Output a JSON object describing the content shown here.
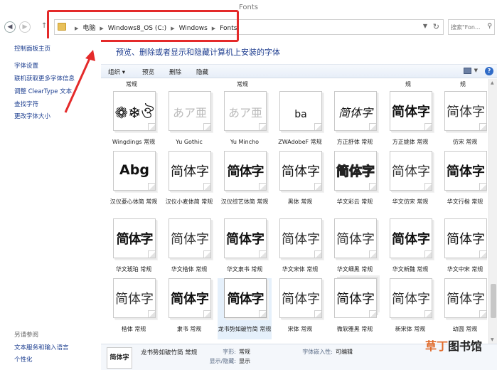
{
  "window": {
    "title": "Fonts"
  },
  "address": {
    "crumbs": [
      "电脑",
      "Windows8_OS (C:)",
      "Windows",
      "Fonts"
    ],
    "search_placeholder": "搜索\"Fon..."
  },
  "left_pane": {
    "links": [
      "控制面板主页",
      "字体设置",
      "联机获取更多字体信息",
      "调整 ClearType 文本",
      "查找字符",
      "更改字体大小"
    ],
    "see_also_title": "另请参阅",
    "see_also_links": [
      "文本服务和输入语言",
      "个性化"
    ]
  },
  "heading": "预览、删除或者显示和隐藏计算机上安装的字体",
  "toolbar": {
    "organize": "组织 ▾",
    "preview": "预览",
    "delete": "删除",
    "hide": "隐藏",
    "help": "?"
  },
  "top_row_labels": [
    "常规",
    "常规",
    "规",
    "规"
  ],
  "fonts": [
    {
      "sample": "❁❄ঔ",
      "name": "Wingdings 常规",
      "style": "sym"
    },
    {
      "sample": "あア亜",
      "name": "Yu Gothic",
      "style": "ghost"
    },
    {
      "sample": "あア亜",
      "name": "Yu Mincho",
      "style": "ghost"
    },
    {
      "sample": "ba",
      "name": "ZWAdobeF 常规",
      "style": "ba"
    },
    {
      "sample": "简体字",
      "name": "方正舒体 常规",
      "style": "cs"
    },
    {
      "sample": "简体字",
      "name": "方正姚体 常规",
      "style": "cb"
    },
    {
      "sample": "简体字",
      "name": "仿宋 常规",
      "style": "cl"
    },
    {
      "sample": "Abg",
      "name": "汉仪菱心体简 常规",
      "style": "abg"
    },
    {
      "sample": "简体字",
      "name": "汉仪小麦体简 常规",
      "style": "cm"
    },
    {
      "sample": "简体字",
      "name": "汉仪综艺体简 常规",
      "style": "cx"
    },
    {
      "sample": "简体字",
      "name": "黑体 常规",
      "style": "cm"
    },
    {
      "sample": "简体字",
      "name": "华文彩云 常规",
      "style": "co"
    },
    {
      "sample": "简体字",
      "name": "华文仿宋 常规",
      "style": "cl"
    },
    {
      "sample": "简体字",
      "name": "华文行楷 常规",
      "style": "cb"
    },
    {
      "sample": "简体字",
      "name": "华文琥珀 常规",
      "style": "cx"
    },
    {
      "sample": "简体字",
      "name": "华文楷体 常规",
      "style": "cl"
    },
    {
      "sample": "简体字",
      "name": "华文隶书 常规",
      "style": "cb"
    },
    {
      "sample": "简体字",
      "name": "华文宋体 常规",
      "style": "cl"
    },
    {
      "sample": "简体字",
      "name": "华文细黑 常规",
      "style": "cl"
    },
    {
      "sample": "简体字",
      "name": "华文新魏 常规",
      "style": "cb"
    },
    {
      "sample": "简体字",
      "name": "华文中宋 常规",
      "style": "cm"
    },
    {
      "sample": "简体字",
      "name": "楷体 常规",
      "style": "cl"
    },
    {
      "sample": "简体字",
      "name": "隶书 常规",
      "style": "cb"
    },
    {
      "sample": "简体字",
      "name": "龙书势如破竹简 常规",
      "style": "cx"
    },
    {
      "sample": "简体字",
      "name": "宋体 常规",
      "style": "cl"
    },
    {
      "sample": "简体字",
      "name": "微软雅黑 常规",
      "style": "cm"
    },
    {
      "sample": "简体字",
      "name": "新宋体 常规",
      "style": "cl"
    },
    {
      "sample": "简体字",
      "name": "幼圆 常规",
      "style": "cl"
    }
  ],
  "details": {
    "thumb": "简体字",
    "name": "龙书势如破竹简 常规",
    "style_label": "字形:",
    "style_value": "常规",
    "show_label": "显示/隐藏:",
    "show_value": "显示",
    "embed_label": "字体嵌入性:",
    "embed_value": "可编辑"
  },
  "watermark": {
    "a": "草丁",
    "b": "图书馆"
  },
  "colors": {
    "annotation_red": "#e42a2a",
    "link_blue": "#1a3c8f"
  }
}
